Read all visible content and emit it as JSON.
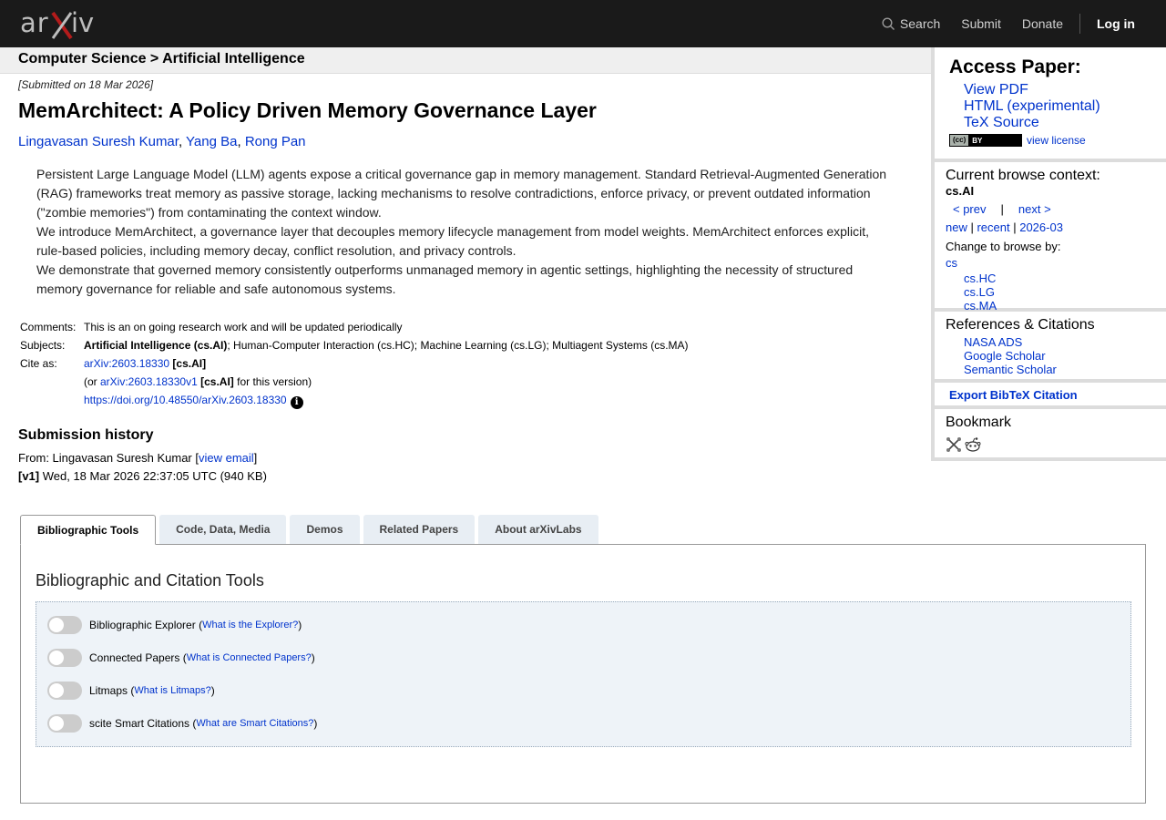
{
  "header": {
    "logo_alt": "arXiv",
    "nav": {
      "search": "Search",
      "submit": "Submit",
      "donate": "Donate",
      "login": "Log in"
    }
  },
  "breadcrumb": "Computer Science > Artificial Intelligence",
  "paper": {
    "submitted": "[Submitted on 18 Mar 2026]",
    "title": "MemArchitect: A Policy Driven Memory Governance Layer",
    "authors": [
      "Lingavasan Suresh Kumar",
      "Yang Ba",
      "Rong Pan"
    ],
    "abstract": [
      "Persistent Large Language Model (LLM) agents expose a critical governance gap in memory management. Standard Retrieval-Augmented Generation (RAG) frameworks treat memory as passive storage, lacking mechanisms to resolve contradictions, enforce privacy, or prevent outdated information (\"zombie memories\") from contaminating the context window.",
      "We introduce MemArchitect, a governance layer that decouples memory lifecycle management from model weights. MemArchitect enforces explicit, rule-based policies, including memory decay, conflict resolution, and privacy controls.",
      "We demonstrate that governed memory consistently outperforms unmanaged memory in agentic settings, highlighting the necessity of structured memory governance for reliable and safe autonomous systems."
    ],
    "comments_label": "Comments:",
    "comments": "This is an on going research work and will be updated periodically",
    "subjects_label": "Subjects:",
    "subjects_primary": "Artificial Intelligence (cs.AI)",
    "subjects_rest": "; Human-Computer Interaction (cs.HC); Machine Learning (cs.LG); Multiagent Systems (cs.MA)",
    "cite_label": "Cite as:",
    "cite_id": "arXiv:2603.18330",
    "cite_cat": "[cs.AI]",
    "cite_or": "(or ",
    "cite_v1": "arXiv:2603.18330v1",
    "cite_v1_suffix": " for this version)",
    "doi": "https://doi.org/10.48550/arXiv.2603.18330",
    "history_title": "Submission history",
    "history_from": "From: Lingavasan Suresh Kumar [",
    "history_email": "view email",
    "history_close": "]",
    "history_v1": "[v1]",
    "history_date": " Wed, 18 Mar 2026 22:37:05 UTC (940 KB)"
  },
  "sidebar": {
    "access_title": "Access Paper:",
    "links": [
      "View PDF",
      "HTML (experimental)",
      "TeX Source"
    ],
    "license_badge_left": "(cc)",
    "license_badge_right": "BY",
    "license_link": "view license",
    "context_head": "Current browse context:",
    "context": "cs.AI",
    "prev": "< prev",
    "pipe": "|",
    "next": "next >",
    "new": "new",
    "recent": "recent",
    "month": "2026-03",
    "sep": " | ",
    "change_head": "Change to browse by:",
    "browse_main": "cs",
    "browse_sub": [
      "cs.HC",
      "cs.LG",
      "cs.MA"
    ],
    "refs_head": "References & Citations",
    "refs": [
      "NASA ADS",
      "Google Scholar",
      "Semantic Scholar"
    ],
    "export": "Export BibTeX Citation",
    "bookmark_head": "Bookmark"
  },
  "tabs": {
    "items": [
      "Bibliographic Tools",
      "Code, Data, Media",
      "Demos",
      "Related Papers",
      "About arXivLabs"
    ],
    "panel_title": "Bibliographic and Citation Tools",
    "toggles": [
      {
        "label": "Bibliographic Explorer",
        "help": "What is the Explorer?"
      },
      {
        "label": "Connected Papers",
        "help": "What is Connected Papers?"
      },
      {
        "label": "Litmaps",
        "help": "What is Litmaps?"
      },
      {
        "label": "scite Smart Citations",
        "help": "What are Smart Citations?"
      }
    ]
  },
  "colors": {
    "link": "#0033cc",
    "topbar": "#1a1a1a",
    "arxiv_red": "#b31b1b"
  }
}
